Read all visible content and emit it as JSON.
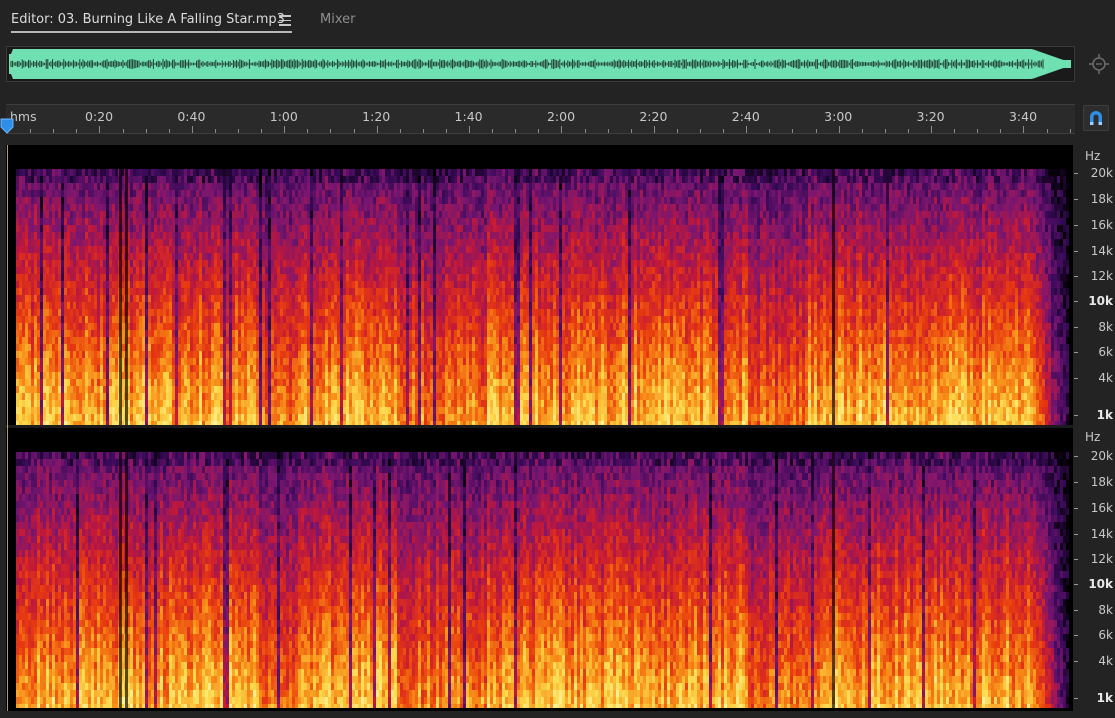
{
  "tabs": {
    "editor_label": "Editor: 03. Burning Like A Falling Star.mp3",
    "mixer_label": "Mixer"
  },
  "ruler": {
    "unit_label": "hms",
    "time_labels": [
      "0:20",
      "0:40",
      "1:00",
      "1:20",
      "1:40",
      "2:00",
      "2:20",
      "2:40",
      "3:00",
      "3:20",
      "3:40"
    ]
  },
  "hz_axis": {
    "unit_label": "Hz",
    "labels": [
      "20k",
      "18k",
      "16k",
      "14k",
      "12k",
      "10k",
      "8k",
      "6k",
      "4k",
      "1k"
    ],
    "bold_labels": [
      "10k",
      "1k"
    ]
  },
  "colors": {
    "waveform": "#6fe0b2",
    "accent_blue": "#2f8ee8",
    "spectrogram": [
      "#000000",
      "#3a0a5a",
      "#7a1670",
      "#c0183a",
      "#e83a10",
      "#f78a16",
      "#fcd84a",
      "#fff2a0"
    ]
  },
  "icons": {
    "tab_menu": "hamburger-menu-icon",
    "zoom": "zoom-navigator-icon",
    "snap": "magnet-icon",
    "playhead": "playhead-marker-icon"
  }
}
